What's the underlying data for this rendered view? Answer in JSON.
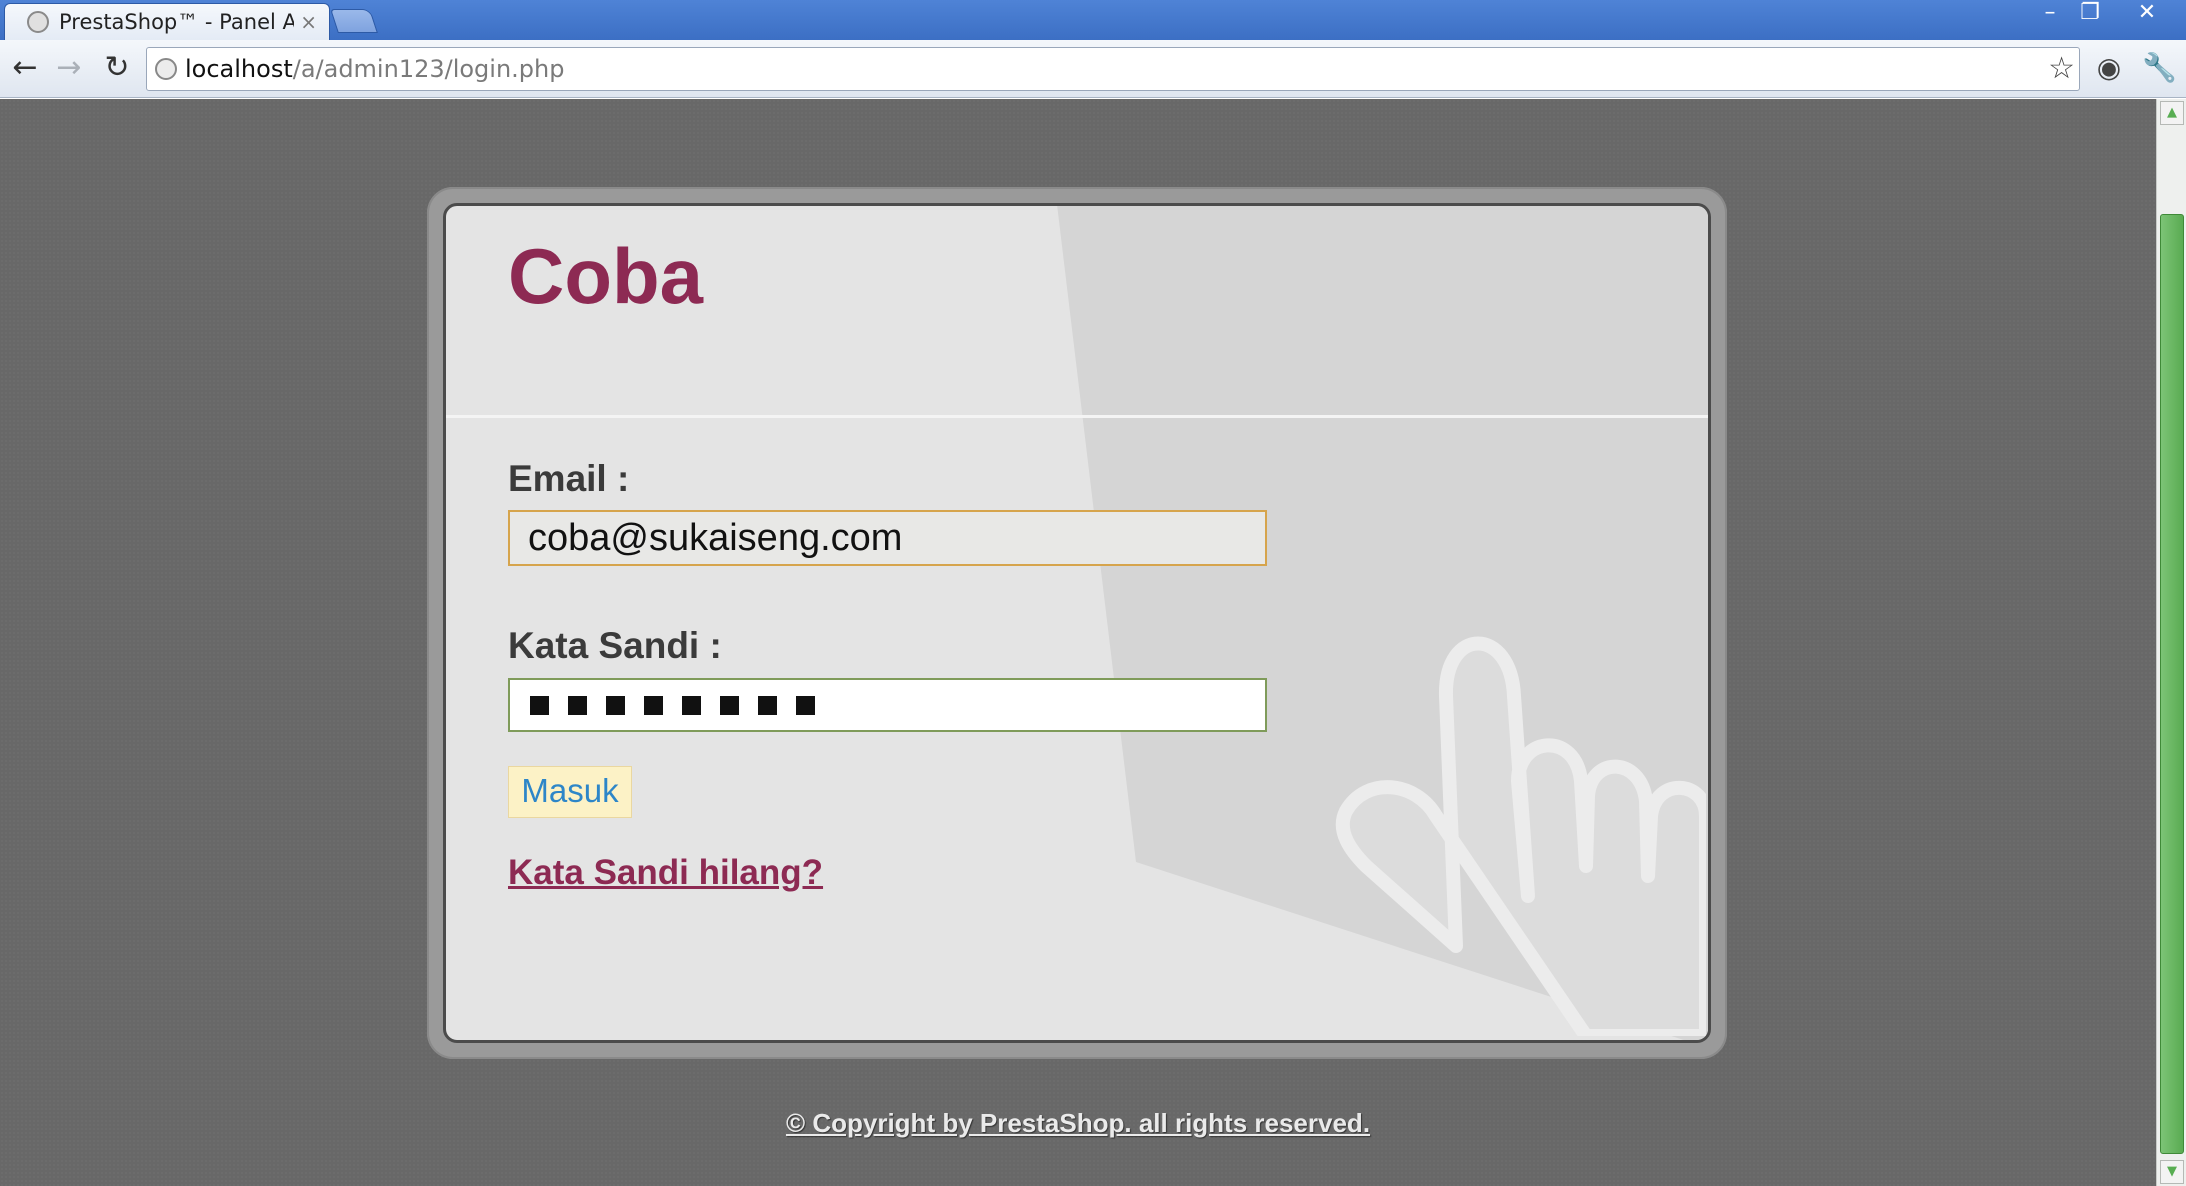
{
  "browser": {
    "tab_title": "PrestaShop™ - Panel Adn",
    "tab_close": "×",
    "url_host": "localhost",
    "url_path": "/a/admin123/login.php"
  },
  "login": {
    "shop_name": "Coba",
    "email_label": "Email :",
    "email_value": "coba@sukaiseng.com",
    "password_label": "Kata Sandi :",
    "password_length": 8,
    "submit_label": "Masuk",
    "lost_password_link": "Kata Sandi hilang?"
  },
  "footer": {
    "copyright": "© Copyright by PrestaShop. all rights reserved."
  },
  "colors": {
    "accent": "#8d2a53",
    "link_blue": "#2d86c8",
    "page_background": "#686868",
    "card_background": "#e4e4e4"
  }
}
